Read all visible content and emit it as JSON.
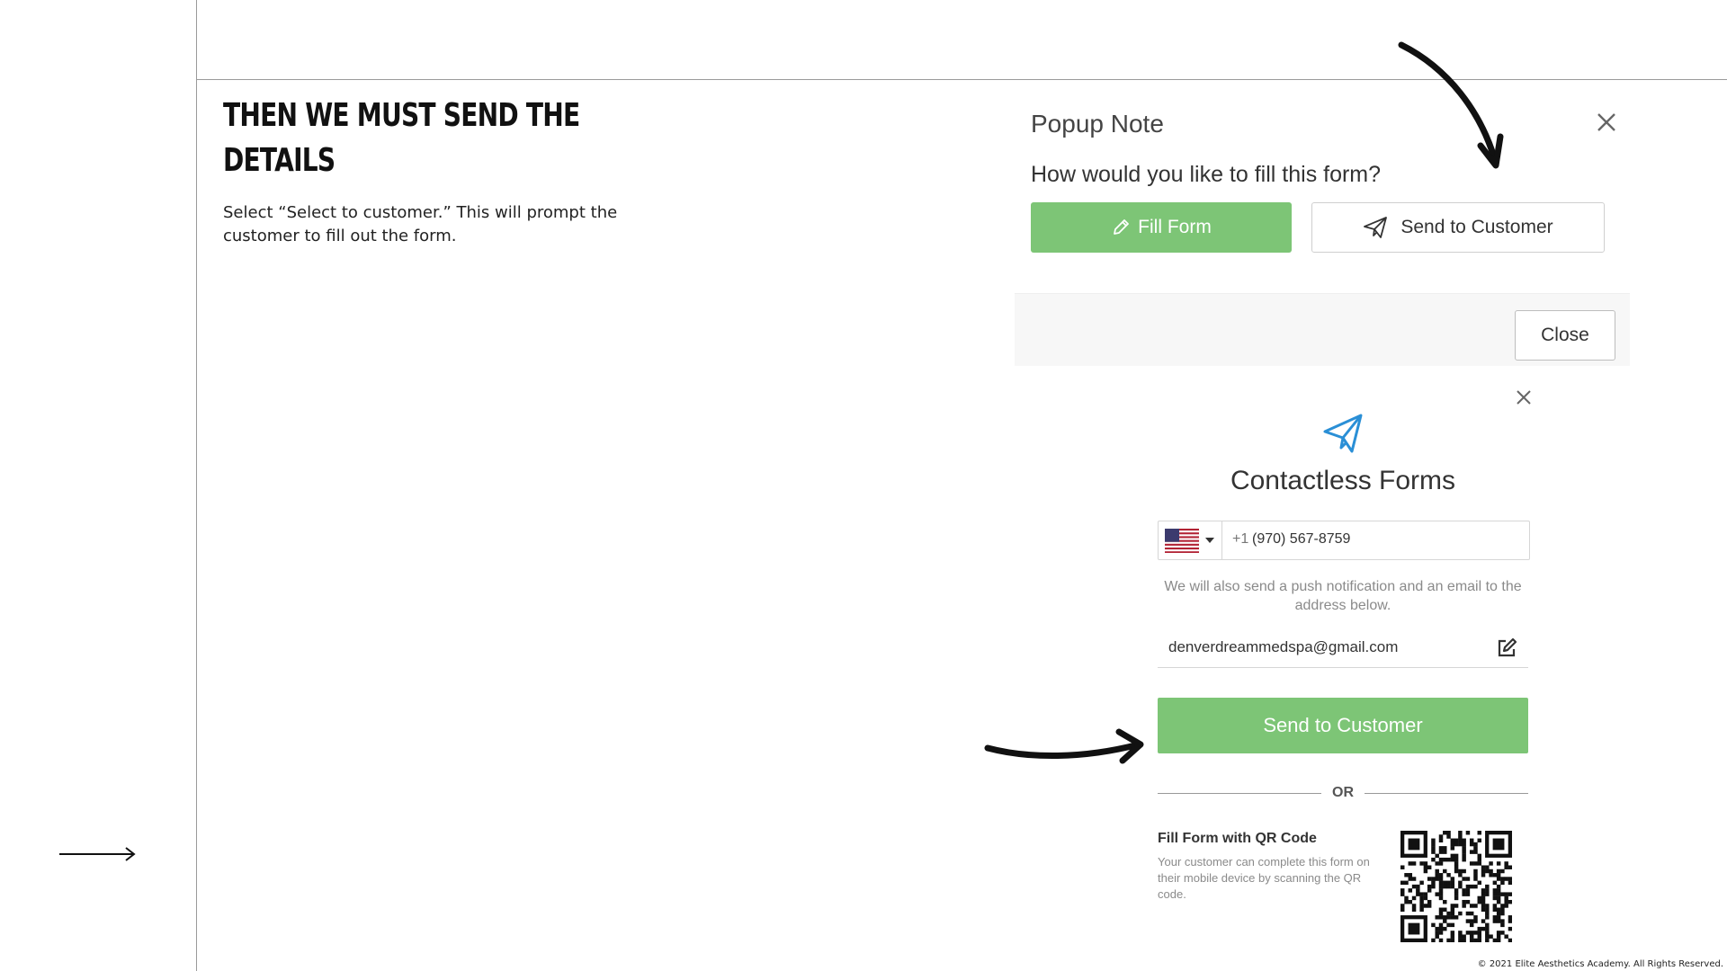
{
  "slide": {
    "heading": "Then we must send the details",
    "description": "Select “Select to customer.” This will prompt the customer to fill out the form.",
    "copyright": "© 2021 Elite Aesthetics Academy. All Rights Reserved."
  },
  "popup": {
    "title": "Popup Note",
    "question": "How would you like to fill this form?",
    "fill_form_label": "Fill Form",
    "send_to_customer_label": "Send to Customer",
    "close_label": "Close"
  },
  "contactless": {
    "title": "Contactless Forms",
    "country_flag": "us-flag-icon",
    "dial_code": "+1",
    "phone": "(970) 567-8759",
    "note": "We will also send a push notification and an email to the address below.",
    "email": "denverdreammedspa@gmail.com",
    "send_button_label": "Send to Customer",
    "or_label": "OR",
    "qr_title": "Fill Form with QR Code",
    "qr_description": "Your customer can complete this form on their mobile device by scanning the QR code."
  },
  "colors": {
    "accent_green": "#7dc576",
    "icon_blue": "#2a8fd6"
  }
}
